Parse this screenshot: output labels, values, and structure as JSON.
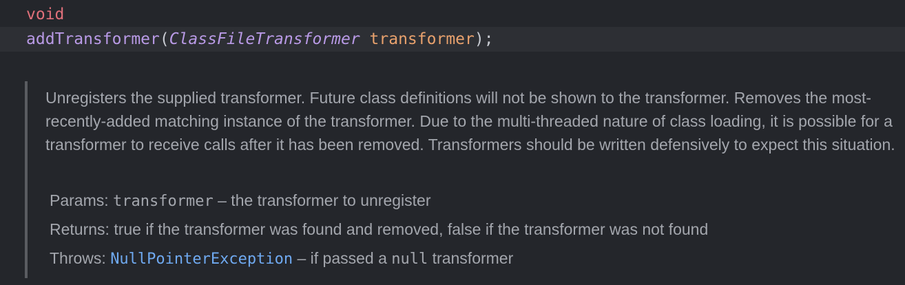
{
  "code": {
    "return_type": "void",
    "method_name": "addTransformer",
    "open_paren": "(",
    "param_type": "ClassFileTransformer",
    "space": " ",
    "param_name": "transformer",
    "close": ");"
  },
  "doc": {
    "description": "Unregisters the supplied transformer. Future class definitions will not be shown to the transformer. Removes the most-recently-added matching instance of the transformer. Due to the multi-threaded nature of class loading, it is possible for a transformer to receive calls after it has been removed. Transformers should be written defensively to expect this situation.",
    "params": {
      "label": "Params:",
      "name": "transformer",
      "text": " – the transformer to unregister"
    },
    "returns": {
      "label": "Returns:",
      "text": "true if the transformer was found and removed, false if the transformer was not found"
    },
    "throws": {
      "label": "Throws:",
      "exception": "NullPointerException",
      "text_before": " – if passed a ",
      "null_literal": "null",
      "text_after": " transformer"
    }
  },
  "colors": {
    "background": "#24262b",
    "highlight_line": "#2d2f34",
    "keyword": "#e0707a",
    "method": "#b99ae6",
    "parameter": "#e8a16d",
    "doc_text": "#a3a6ad",
    "link": "#6fa9f0"
  }
}
